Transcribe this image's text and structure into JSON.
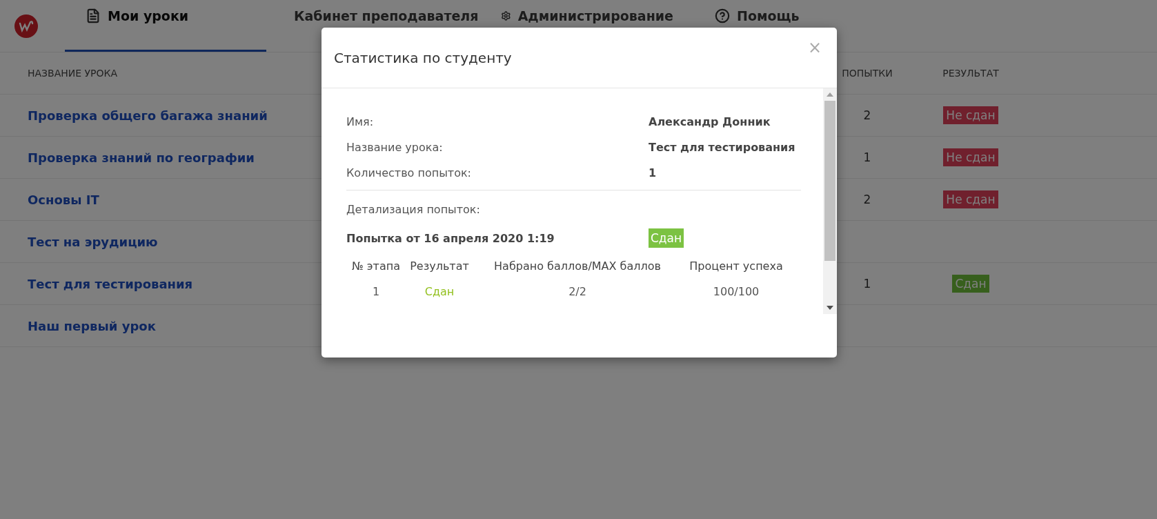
{
  "nav": {
    "tabs": [
      {
        "label": "Мои уроки",
        "selected": true
      },
      {
        "label": "Кабинет преподавателя",
        "selected": false
      },
      {
        "label": "Администрирование",
        "selected": false
      },
      {
        "label": "Помощь",
        "selected": false
      }
    ]
  },
  "lessons": {
    "columns": [
      "НАЗВАНИЕ УРОКА",
      "ПОПЫТКИ",
      "РЕЗУЛЬТАТ"
    ],
    "rows": [
      {
        "name": "Проверка общего багажа знаний",
        "attempts": "2",
        "result": {
          "label": "Не сдан",
          "passed": false
        }
      },
      {
        "name": "Проверка знаний по географии",
        "attempts": "1",
        "result": {
          "label": "Не сдан",
          "passed": false
        }
      },
      {
        "name": "Основы IT",
        "attempts": "2",
        "result": {
          "label": "Не сдан",
          "passed": false
        }
      },
      {
        "name": "Тест на эрудицию"
      },
      {
        "name": "Тест для тестирования",
        "attempts": "1",
        "result": {
          "label": "Сдан",
          "passed": true
        }
      },
      {
        "name": "Наш первый урок"
      }
    ]
  },
  "modal": {
    "title": "Статистика по студенту",
    "close": "×",
    "fields": [
      {
        "label": "Имя:",
        "value": "Александр Донник"
      },
      {
        "label": "Название урока:",
        "value": "Тест для тестирования"
      },
      {
        "label": "Количество попыток:",
        "value": "1"
      }
    ],
    "details_label": "Детализация попыток:",
    "attempt": {
      "title": "Попытка от 16 апреля 2020 1:19",
      "result": {
        "label": "Сдан",
        "passed": true
      }
    },
    "stages": {
      "columns": [
        "№ этапа",
        "Результат",
        "Набрано баллов/MAX баллов",
        "Процент успеха"
      ],
      "rows": [
        {
          "stage": "1",
          "result": "Сдан",
          "passed": true,
          "score": "2/2",
          "percent": "100/100"
        }
      ]
    }
  }
}
